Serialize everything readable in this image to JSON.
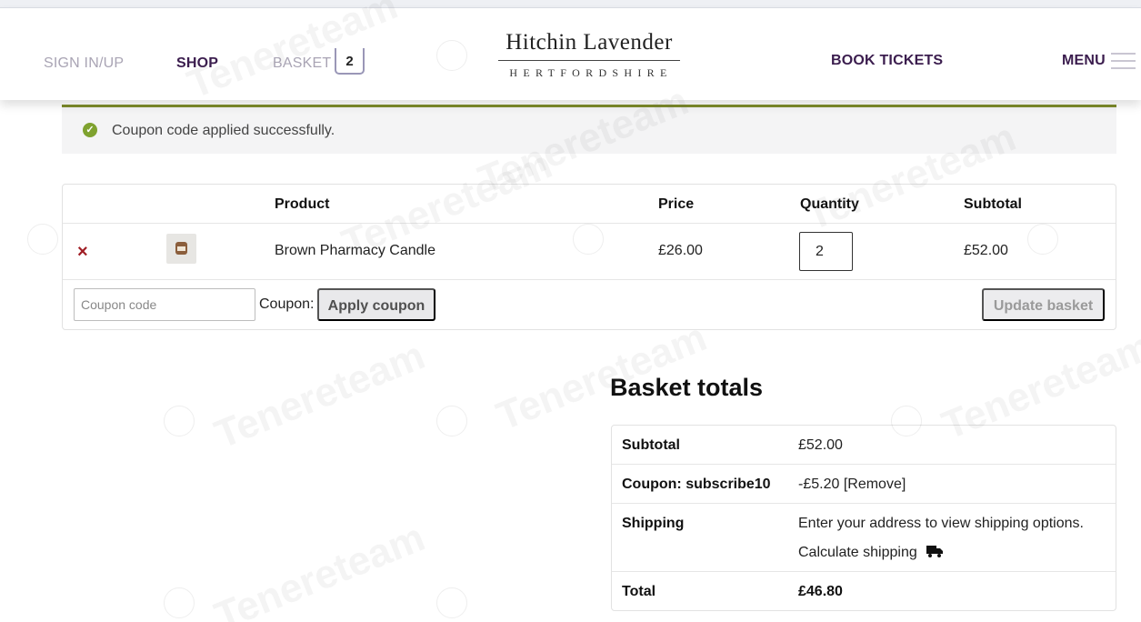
{
  "header": {
    "nav": {
      "signin": "SIGN IN/UP",
      "shop": "SHOP",
      "basket": "BASKET",
      "basket_count": "2",
      "tickets": "BOOK TICKETS",
      "menu": "MENU"
    },
    "logo": {
      "title": "Hitchin Lavender",
      "subtitle": "HERTFORDSHIRE"
    }
  },
  "notice": {
    "message": "Coupon code applied successfully."
  },
  "cart": {
    "columns": [
      "Product",
      "Price",
      "Quantity",
      "Subtotal"
    ],
    "items": [
      {
        "remove_symbol": "×",
        "product": "Brown Pharmacy Candle",
        "price": "£26.00",
        "quantity": "2",
        "subtotal": "£52.00"
      }
    ],
    "coupon_placeholder": "Coupon code",
    "coupon_label": "Coupon:",
    "apply_label": "Apply coupon",
    "update_label": "Update basket"
  },
  "totals": {
    "title": "Basket totals",
    "subtotal_label": "Subtotal",
    "subtotal_value": "£52.00",
    "coupon_label": "Coupon: subscribe10",
    "coupon_value": "-£5.20 [Remove]",
    "shipping_label": "Shipping",
    "shipping_text": "Enter your address to view shipping options.",
    "calc_shipping": "Calculate shipping",
    "total_label": "Total",
    "total_value": "£46.80"
  },
  "watermark": "Tenereteam",
  "colors": {
    "brand_purple": "#3b1d4e",
    "notice_accent": "#7d8b2b",
    "success_green": "#7fa22f",
    "remove_red": "#a01d24"
  },
  "icons": [
    "check-circle-icon",
    "remove-icon",
    "product-thumbnail",
    "truck-icon",
    "hamburger-icon"
  ]
}
